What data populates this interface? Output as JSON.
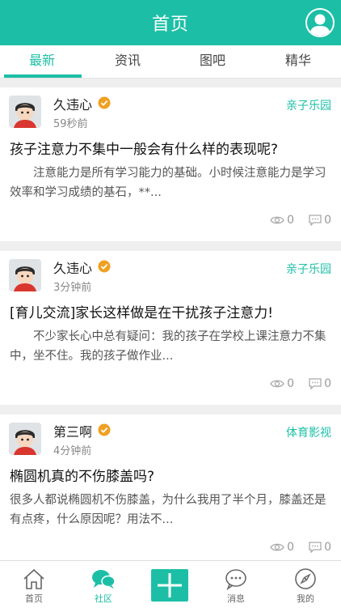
{
  "header": {
    "title": "首页"
  },
  "tabs": [
    {
      "label": "最新"
    },
    {
      "label": "资讯"
    },
    {
      "label": "图吧"
    },
    {
      "label": "精华"
    }
  ],
  "posts": [
    {
      "author": "久违心",
      "time": "59秒前",
      "category": "亲子乐园",
      "title": "孩子注意力不集中一般会有什么样的表现呢?",
      "excerpt": "　　注意能力是所有学习能力的基础。小时候注意能力是学习效率和学习成绩的基石，**...",
      "views": "0",
      "comments": "0"
    },
    {
      "author": "久违心",
      "time": "3分钟前",
      "category": "亲子乐园",
      "title": "[育儿交流]家长这样做是在干扰孩子注意力!",
      "excerpt": "　　不少家长心中总有疑问：我的孩子在学校上课注意力不集中，坐不住。我的孩子做作业...",
      "views": "0",
      "comments": "0"
    },
    {
      "author": "第三啊",
      "time": "4分钟前",
      "category": "体育影视",
      "title": "椭圆机真的不伤膝盖吗?",
      "excerpt": "很多人都说椭圆机不伤膝盖，为什么我用了半个月，膝盖还是有点疼，什么原因呢？用法不...",
      "views": "0",
      "comments": "0"
    }
  ],
  "bottom_nav": [
    {
      "label": "首页",
      "icon": "home-icon"
    },
    {
      "label": "社区",
      "icon": "community-icon"
    },
    {
      "label": "",
      "icon": "plus-icon"
    },
    {
      "label": "消息",
      "icon": "message-icon"
    },
    {
      "label": "我的",
      "icon": "compass-icon"
    }
  ],
  "colors": {
    "accent": "#1cbfa6",
    "verified": "#f0a020"
  }
}
